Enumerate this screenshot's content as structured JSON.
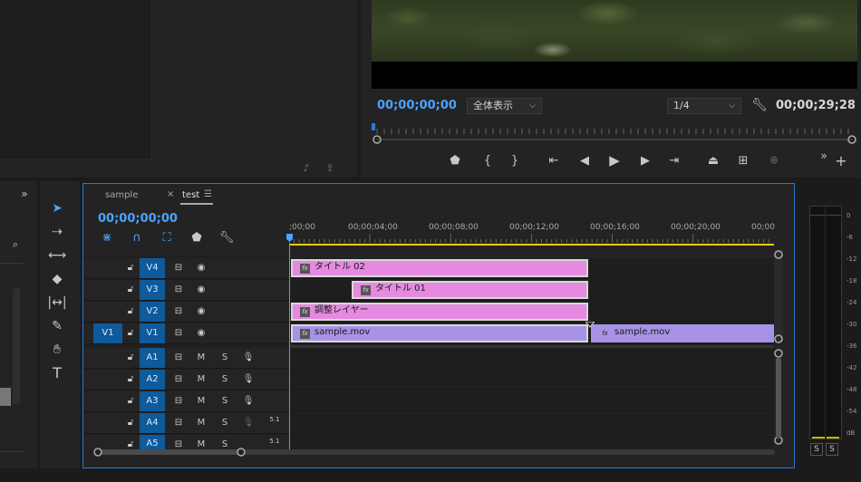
{
  "program": {
    "timecode_current": "00;00;00;00",
    "zoom": "全体表示",
    "resolution": "1/4",
    "timecode_duration": "00;00;29;28"
  },
  "timeline": {
    "tabs": [
      {
        "label": "sample"
      },
      {
        "label": "test"
      }
    ],
    "timecode": "00;00;00;00",
    "ruler": [
      ";00;00",
      "00;00;04;00",
      "00;00;08;00",
      "00;00;12;00",
      "00;00;16;00",
      "00;00;20;00",
      "00;00"
    ],
    "video_tracks": [
      {
        "target": "V4"
      },
      {
        "target": "V3"
      },
      {
        "target": "V2"
      },
      {
        "target": "V1",
        "source": "V1"
      }
    ],
    "audio_tracks": [
      {
        "target": "A1",
        "m": "M",
        "s": "S",
        "ch": ""
      },
      {
        "target": "A2",
        "m": "M",
        "s": "S",
        "ch": ""
      },
      {
        "target": "A3",
        "m": "M",
        "s": "S",
        "ch": ""
      },
      {
        "target": "A4",
        "m": "M",
        "s": "S",
        "ch": "5.1"
      },
      {
        "target": "A5",
        "m": "M",
        "s": "S",
        "ch": "5.1"
      }
    ],
    "clips": [
      {
        "name": "タイトル 02",
        "track": "V4",
        "color": "#e58ae0"
      },
      {
        "name": "タイトル 01",
        "track": "V3",
        "color": "#e58ae0"
      },
      {
        "name": "調整レイヤー",
        "track": "V2",
        "color": "#e58ae0"
      },
      {
        "name": "sample.mov",
        "track": "V1",
        "color": "#a892e6"
      },
      {
        "name": "sample.mov",
        "track": "V1",
        "color": "#a892e6"
      }
    ]
  },
  "meter": {
    "scale": [
      "0",
      "-6",
      "-12",
      "-18",
      "-24",
      "-30",
      "-36",
      "-42",
      "-48",
      "-54",
      "dB"
    ],
    "solo_labels": [
      "S",
      "S"
    ]
  },
  "colors": {
    "accent_blue": "#4aa3ff",
    "target_blue": "#0e5a9a",
    "playhead_blue": "#2b79d4",
    "work_area_yellow": "#e8d000"
  }
}
